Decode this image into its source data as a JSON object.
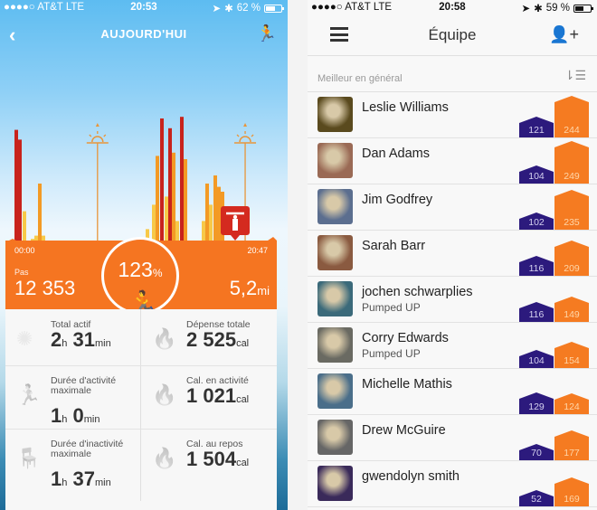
{
  "left": {
    "status_bar": {
      "carrier": "●●●●○ AT&T  LTE",
      "time": "20:53",
      "battery": "62 %",
      "battery_level": 0.62
    },
    "header": {
      "back_icon": "chevron-left-icon",
      "title": "AUJOURD'HUI",
      "add_activity_icon": "runner-plus-icon"
    },
    "activity_chart": {
      "start_time": "00:00",
      "end_time": "20:47",
      "markers": [
        {
          "type": "sunrise",
          "icon": "sunrise-icon",
          "position": 0.35
        },
        {
          "type": "sunset",
          "icon": "sunset-icon",
          "position": 0.88
        }
      ],
      "workout_badge_icon": "weightlifting-icon",
      "colors": {
        "intense": "#c8231c",
        "active": "#f39a25",
        "light": "#f7c948"
      }
    },
    "summary": {
      "steps_label": "Pas",
      "steps": "12 353",
      "goal_percent": "123",
      "percent_sign": "%",
      "distance": "5,2",
      "distance_unit": "mi"
    },
    "stats": [
      {
        "icon": "activity-burst-icon",
        "label": "Total actif",
        "v1": "2",
        "u1": "h",
        "v2": "31",
        "u2": "min"
      },
      {
        "icon": "flames-icon",
        "label": "Dépense totale",
        "v1": "2 525",
        "u1": "cal"
      },
      {
        "icon": "running-person-icon",
        "label": "Durée d'activité maximale",
        "v1": "1",
        "u1": "h",
        "v2": "0",
        "u2": "min"
      },
      {
        "icon": "flame-icon",
        "label": "Cal. en activité",
        "v1": "1 021",
        "u1": "cal"
      },
      {
        "icon": "chair-icon",
        "label": "Durée d'inactivité maximale",
        "v1": "1",
        "u1": "h",
        "v2": "37",
        "u2": "min"
      },
      {
        "icon": "flame-icon",
        "label": "Cal. au repos",
        "v1": "1 504",
        "u1": "cal"
      }
    ]
  },
  "right": {
    "status_bar": {
      "carrier": "●●●●○ AT&T  LTE",
      "time": "20:58",
      "battery": "59 %",
      "battery_level": 0.59
    },
    "header": {
      "menu_icon": "hamburger-icon",
      "title": "Équipe",
      "add_user_icon": "add-user-icon"
    },
    "sort_label": "Meilleur en général",
    "sort_icon": "sort-icon",
    "colors": {
      "purple": "#2c1a7d",
      "orange": "#f57b21"
    },
    "members": [
      {
        "name": "Leslie Williams",
        "subtitle": "",
        "purple": 121,
        "orange": 244,
        "avatar_color": "#5a4a1e"
      },
      {
        "name": "Dan Adams",
        "subtitle": "",
        "purple": 104,
        "orange": 249,
        "avatar_color": "#9a6a55"
      },
      {
        "name": "Jim Godfrey",
        "subtitle": "",
        "purple": 102,
        "orange": 235,
        "avatar_color": "#5b6e8f"
      },
      {
        "name": "Sarah Barr",
        "subtitle": "",
        "purple": 116,
        "orange": 209,
        "avatar_color": "#8a5a40"
      },
      {
        "name": "jochen schwarplies",
        "subtitle": "Pumped UP",
        "purple": 116,
        "orange": 149,
        "avatar_color": "#3b6a7a"
      },
      {
        "name": "Corry Edwards",
        "subtitle": "Pumped UP",
        "purple": 104,
        "orange": 154,
        "avatar_color": "#6a6a62"
      },
      {
        "name": "Michelle Mathis",
        "subtitle": "",
        "purple": 129,
        "orange": 124,
        "avatar_color": "#4a6e8a"
      },
      {
        "name": "Drew McGuire",
        "subtitle": "",
        "purple": 70,
        "orange": 177,
        "avatar_color": "#666666"
      },
      {
        "name": "gwendolyn smith",
        "subtitle": "",
        "purple": 52,
        "orange": 169,
        "avatar_color": "#3a2a5a"
      }
    ]
  }
}
